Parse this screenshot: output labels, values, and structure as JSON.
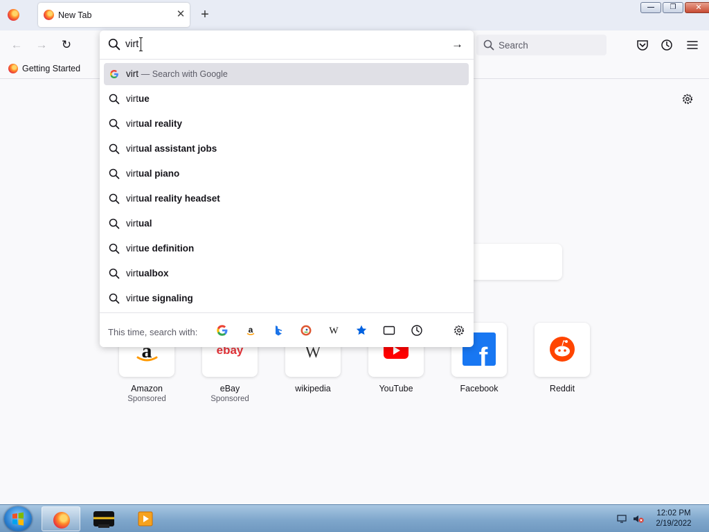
{
  "browser": {
    "tab_title": "New Tab",
    "tab_close_glyph": "✕",
    "new_tab_glyph": "+",
    "window_controls": {
      "minimize": "—",
      "restore": "❐",
      "close": "✕"
    }
  },
  "navbar": {
    "back_glyph": "←",
    "forward_glyph": "→",
    "reload_glyph": "↻",
    "search_placeholder": "Search"
  },
  "bookmarks": [
    {
      "label": "Getting Started"
    }
  ],
  "urlbar": {
    "typed_text": "virt",
    "go_glyph": "→",
    "heuristic": {
      "query": "virt",
      "action": "— Search with Google"
    },
    "suggestions": [
      {
        "typed": "virt",
        "completion": "ue"
      },
      {
        "typed": "virt",
        "completion": "ual reality"
      },
      {
        "typed": "virt",
        "completion": "ual assistant jobs"
      },
      {
        "typed": "virt",
        "completion": "ual piano"
      },
      {
        "typed": "virt",
        "completion": "ual reality headset"
      },
      {
        "typed": "virt",
        "completion": "ual"
      },
      {
        "typed": "virt",
        "completion": "ue definition"
      },
      {
        "typed": "virt",
        "completion": "ualbox"
      },
      {
        "typed": "virt",
        "completion": "ue signaling"
      }
    ],
    "oneoff_label": "This time, search with:",
    "oneoff_engines": [
      "google-icon",
      "amazon-icon",
      "bing-icon",
      "duckduckgo-icon",
      "wikipedia-icon",
      "bookmarks-icon",
      "tabs-icon",
      "history-icon"
    ]
  },
  "top_sites": [
    {
      "name": "Amazon",
      "sub": "Sponsored",
      "icon": "amazon-logo"
    },
    {
      "name": "eBay",
      "sub": "Sponsored",
      "icon": "ebay-logo"
    },
    {
      "name": "wikipedia",
      "sub": "",
      "icon": "wikipedia-logo"
    },
    {
      "name": "YouTube",
      "sub": "",
      "icon": "youtube-logo"
    },
    {
      "name": "Facebook",
      "sub": "",
      "icon": "facebook-logo"
    },
    {
      "name": "Reddit",
      "sub": "",
      "icon": "reddit-logo"
    }
  ],
  "logo_text": {
    "amazon": "a",
    "ebay": "ebay",
    "wikipedia": "W",
    "facebook": "f"
  },
  "taskbar": {
    "time": "12:02 PM",
    "date": "2/19/2022"
  },
  "colors": {
    "highlight_row": "#e0e0e6",
    "taskbar": "#7fa7cc",
    "google_blue": "#4285f4",
    "bing_blue": "#1a73e8",
    "youtube_red": "#ff0000",
    "facebook_blue": "#1877f2",
    "reddit_orange": "#ff4500"
  }
}
